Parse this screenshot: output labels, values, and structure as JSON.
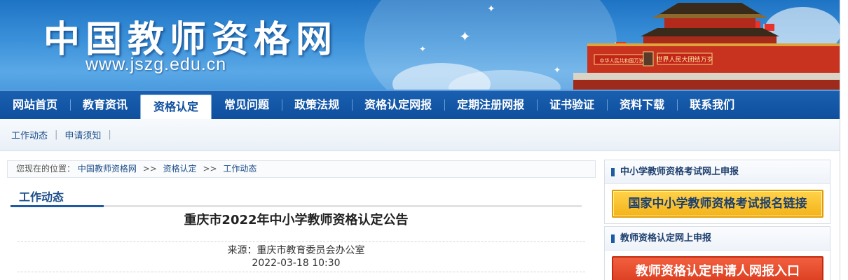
{
  "banner": {
    "title": "中国教师资格网",
    "url": "www.jszg.edu.cn",
    "gate_sign_left": "中华人民共和国万岁",
    "gate_sign_right": "世界人民大团结万岁"
  },
  "nav": {
    "items": [
      {
        "label": "网站首页"
      },
      {
        "label": "教育资讯"
      },
      {
        "label": "资格认定",
        "active": true
      },
      {
        "label": "常见问题"
      },
      {
        "label": "政策法规"
      },
      {
        "label": "资格认定网报"
      },
      {
        "label": "定期注册网报"
      },
      {
        "label": "证书验证"
      },
      {
        "label": "资料下载"
      },
      {
        "label": "联系我们"
      }
    ]
  },
  "subnav": {
    "items": [
      {
        "label": "工作动态"
      },
      {
        "label": "申请须知"
      }
    ],
    "separator": "|"
  },
  "breadcrumb": {
    "prefix": "您现在的位置：",
    "items": [
      "中国教师资格网",
      "资格认定",
      "工作动态"
    ],
    "separator": ">>"
  },
  "section": {
    "title": "工作动态"
  },
  "article": {
    "title": "重庆市2022年中小学教师资格认定公告",
    "source": "来源：重庆市教育委员会办公室",
    "date": "2022-03-18 10:30"
  },
  "sidebar": {
    "box1": {
      "heading": "中小学教师资格考试网上申报",
      "button": "国家中小学教师资格考试报名链接"
    },
    "box2": {
      "heading": "教师资格认定网上申报",
      "button": "教师资格认定申请人网报入口"
    }
  },
  "colors": {
    "nav_blue": "#0f4f9e",
    "banner_blue": "#3b91d9",
    "link_blue": "#1d4f8a",
    "button_yellow": "#f4b319",
    "button_red": "#d8391d",
    "gate_red": "#c8331f"
  }
}
